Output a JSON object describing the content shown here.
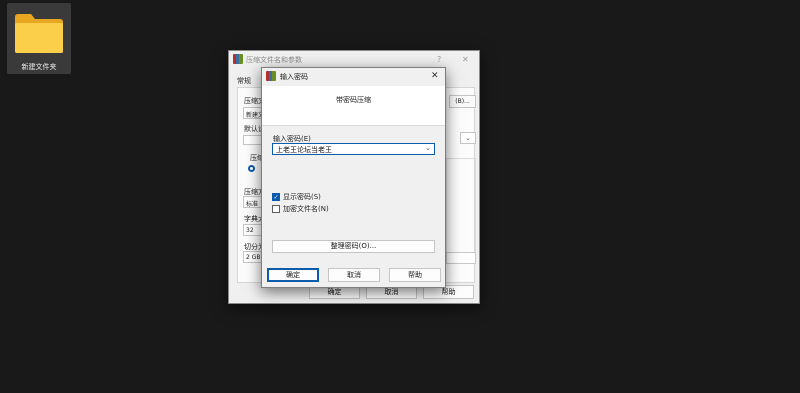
{
  "desktop": {
    "folder_label": "新建文件夹"
  },
  "archive_dialog": {
    "title": "压缩文件名和参数",
    "help_glyph": "?",
    "close_glyph": "✕",
    "tab_general": "常规",
    "label_archive_name": "压缩文",
    "field_archive_name": "新建文",
    "browse_button": "(B)...",
    "label_default": "默认设",
    "label_format": "压缩",
    "label_method": "压缩方",
    "field_method": "标准",
    "label_dict": "字典大",
    "field_dict": "32",
    "label_split": "切分为",
    "field_split": "2 GB",
    "ok_label": "确定",
    "cancel_label": "取消",
    "help_label": "帮助"
  },
  "password_dialog": {
    "title": "输入密码",
    "close_glyph": "✕",
    "header_text": "带密码压缩",
    "password_label": "输入密码(E)",
    "password_value": "上老王论坛当老王",
    "show_password_label": "显示密码(S)",
    "show_password_checked": true,
    "encrypt_names_label": "加密文件名(N)",
    "encrypt_names_checked": false,
    "organize_button": "整理密码(O)...",
    "ok_label": "确定",
    "cancel_label": "取消",
    "help_label": "帮助"
  },
  "colors": {
    "accent": "#0b5cad",
    "desktop": "#191919",
    "dialog_bg": "#f0f0f0"
  }
}
